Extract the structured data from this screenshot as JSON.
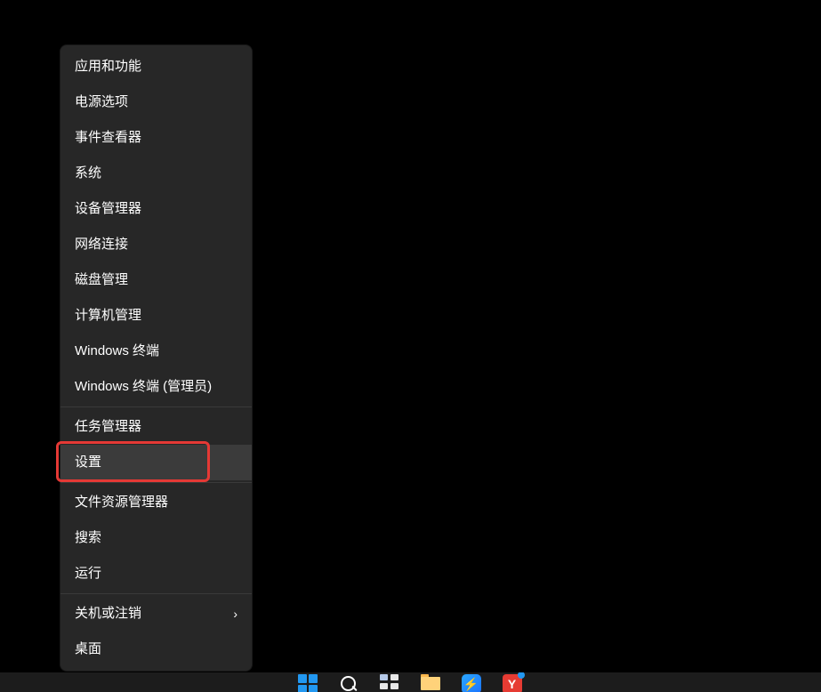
{
  "context_menu": {
    "items": [
      {
        "label": "应用和功能"
      },
      {
        "label": "电源选项"
      },
      {
        "label": "事件查看器"
      },
      {
        "label": "系统"
      },
      {
        "label": "设备管理器"
      },
      {
        "label": "网络连接"
      },
      {
        "label": "磁盘管理"
      },
      {
        "label": "计算机管理"
      },
      {
        "label": "Windows 终端"
      },
      {
        "label": "Windows 终端 (管理员)"
      },
      {
        "separator": true
      },
      {
        "label": "任务管理器"
      },
      {
        "label": "设置",
        "selected": true
      },
      {
        "separator": true
      },
      {
        "label": "文件资源管理器"
      },
      {
        "label": "搜索"
      },
      {
        "label": "运行"
      },
      {
        "separator": true
      },
      {
        "label": "关机或注销",
        "submenu": true
      },
      {
        "label": "桌面"
      }
    ]
  },
  "highlight": {
    "target_label": "设置"
  },
  "taskbar": {
    "icons": [
      {
        "name": "start"
      },
      {
        "name": "search"
      },
      {
        "name": "taskview"
      },
      {
        "name": "file-explorer"
      },
      {
        "name": "thunder",
        "glyph": "⚡"
      },
      {
        "name": "red-app",
        "glyph": "Y"
      }
    ]
  }
}
